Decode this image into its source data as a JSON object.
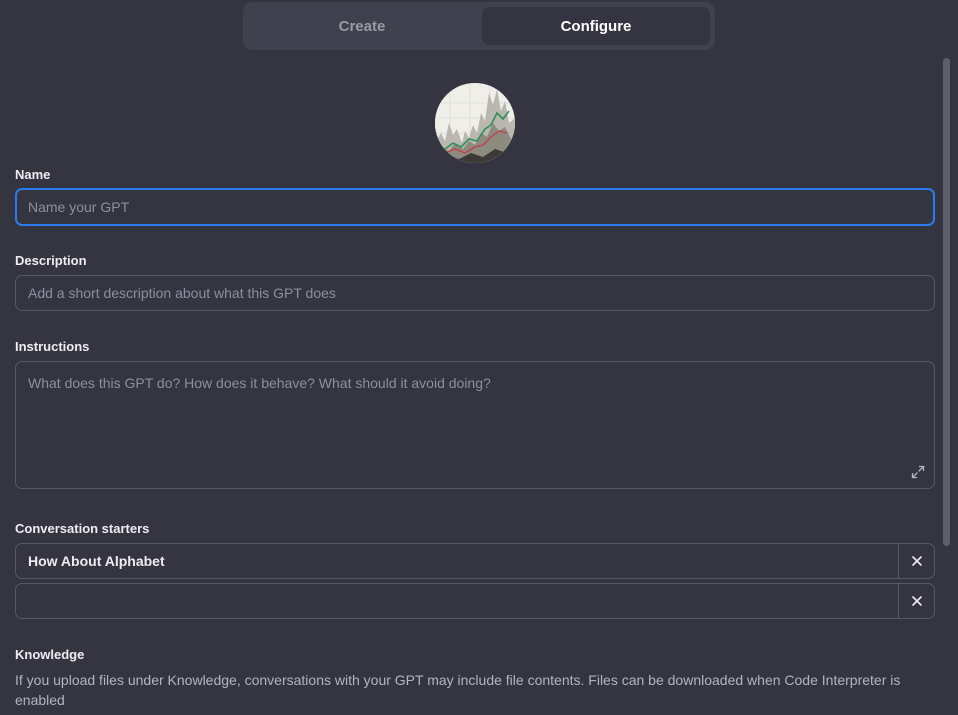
{
  "tabs": {
    "create": "Create",
    "configure": "Configure",
    "active": "Configure"
  },
  "avatar": {
    "description_icon": "chart-thumbnail"
  },
  "fields": {
    "name": {
      "label": "Name",
      "value": "",
      "placeholder": "Name your GPT"
    },
    "description": {
      "label": "Description",
      "value": "",
      "placeholder": "Add a short description about what this GPT does"
    },
    "instructions": {
      "label": "Instructions",
      "value": "",
      "placeholder": "What does this GPT do? How does it behave? What should it avoid doing?"
    }
  },
  "conversation_starters": {
    "label": "Conversation starters",
    "items": [
      {
        "value": "How About Alphabet"
      },
      {
        "value": ""
      }
    ]
  },
  "knowledge": {
    "label": "Knowledge",
    "text": "If you upload files under Knowledge, conversations with your GPT may include file contents. Files can be downloaded when Code Interpreter is enabled"
  },
  "colors": {
    "background": "#343541",
    "tab_bar": "#40414f",
    "focus_border": "#2b7bf0",
    "field_border": "#565869"
  }
}
